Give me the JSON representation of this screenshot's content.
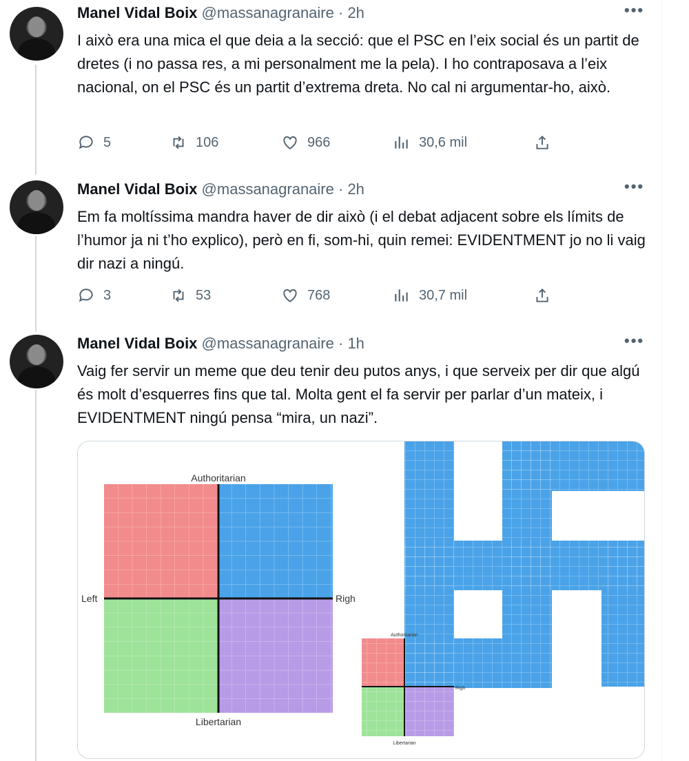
{
  "tweets": [
    {
      "author_name": "Manel Vidal Boix",
      "author_handle": "@massanagranaire",
      "time": "· 2h",
      "text": "I això era una mica el que deia a la secció: que el PSC en l’eix social és un partit de dretes (i no passa res, a mi personalment me la pela). I ho contraposava a l’eix nacional, on el PSC és un partit d’extrema dreta. No cal ni argumentar-ho, això.",
      "replies": "5",
      "retweets": "106",
      "likes": "966",
      "views": "30,6 mil"
    },
    {
      "author_name": "Manel Vidal Boix",
      "author_handle": "@massanagranaire",
      "time": "· 2h",
      "text": "Em fa moltíssima mandra haver de dir això (i el debat adjacent sobre els límits de l’humor ja ni t’ho explico), però en fi, som-hi, quin remei: EVIDENTMENT jo no li vaig dir nazi a ningú.",
      "replies": "3",
      "retweets": "53",
      "likes": "768",
      "views": "30,7 mil"
    },
    {
      "author_name": "Manel Vidal Boix",
      "author_handle": "@massanagranaire",
      "time": "· 1h",
      "text": "Vaig fer servir un meme que deu tenir deu putos anys, i que serveix per dir que algú és molt d’esquerres fins que tal. Molta gent el fa servir per parlar d’un mateix, i EVIDENTMENT ningú pensa “mira, un nazi”."
    }
  ],
  "more_label": "•••",
  "meme": {
    "compass_top": "Authoritarian",
    "compass_bottom": "Libertarian",
    "compass_left": "Left",
    "compass_right": "Righ",
    "small_top": "Authoritarian",
    "small_bottom": "Libertarian",
    "small_right": "Righ",
    "colors": {
      "red": "#f28b8b",
      "blue": "#4aa3e8",
      "green": "#9de39a",
      "purple": "#b89be6"
    }
  },
  "icons": [
    "reply-icon",
    "retweet-icon",
    "like-icon",
    "views-icon",
    "share-icon",
    "more-icon"
  ]
}
